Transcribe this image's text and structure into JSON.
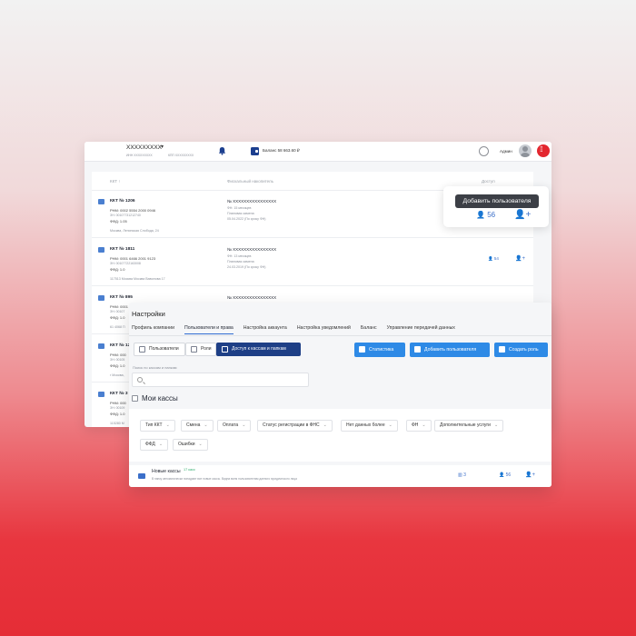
{
  "topbar": {
    "org_name": "XXXXXXXXX",
    "inn": "ИНН XXXXXXXXX",
    "kpp": "КПП XXXXXXXXX",
    "balance": "Баланс 58 663.60 ₽",
    "admin": "Админ"
  },
  "table": {
    "headers": {
      "kkt": "ККТ ↑",
      "fn": "Фискальный накопитель",
      "access": "Доступ"
    },
    "rows": [
      {
        "title": "ККТ № 1206",
        "l1": "РНМ: 0002 5554 2000 0946",
        "l2": "ЗН: 00107731212740",
        "l3": "ФФД: 1.05",
        "addr": "Москва, Ленинская Слобода, 24",
        "fn": "№ XXXXXXXXXXXXXXXX",
        "fn1": "ФН: 15 месяцев",
        "fn2": "Плановая замена",
        "fn3": "05.04.2022 (По сроку ФН)",
        "users": "",
        "add": ""
      },
      {
        "title": "ККТ № 1811",
        "l1": "РНМ: 0001 6466 2001 9123",
        "l2": "ЗН: 00107722163008",
        "l3": "ФФД: 1.0",
        "addr": "117513 Москва Москва Вавилова 17",
        "fn": "№ XXXXXXXXXXXXXXXX",
        "fn1": "ФН: 13 месяцев",
        "fn2": "Плановая замена",
        "fn3": "24.03.2019 (По сроку ФН)",
        "users": "54",
        "add": "+"
      },
      {
        "title": "ККТ № 895",
        "l1": "РНМ: 0001",
        "l2": "ЗН: 00107",
        "l3": "ФФД: 1.0",
        "addr": "61 4068 П",
        "fn": "№ XXXXXXXXXXXXXXXX",
        "fn1": "",
        "fn2": "",
        "fn3": "",
        "users": "",
        "add": ""
      },
      {
        "title": "ККТ № 12",
        "l1": "РНМ: 000",
        "l2": "ЗН: 00105",
        "l3": "ФФД: 1.0",
        "addr": "г Москва,",
        "fn": "",
        "fn1": "",
        "fn2": "",
        "fn3": "",
        "users": "",
        "add": ""
      },
      {
        "title": "ККТ № 3",
        "l1": "РНМ: 000",
        "l2": "ЗН: 00109",
        "l3": "ФФД: 1.0",
        "addr": "115280 М",
        "fn": "",
        "fn1": "",
        "fn2": "",
        "fn3": "",
        "users": "",
        "add": ""
      }
    ]
  },
  "popup": {
    "tooltip": "Добавить пользователя",
    "users": "56"
  },
  "settings": {
    "title": "Настройки",
    "tabs": [
      "Профиль компании",
      "Пользователи и права",
      "Настройка аккаунта",
      "Настройка уведомлений",
      "Баланс",
      "Управление передачей данных"
    ],
    "segments": [
      "Пользователи",
      "Роли",
      "Доступ к кассам и папкам"
    ],
    "buttons": [
      "Статистика",
      "Добавить пользователя",
      "Создать роль"
    ],
    "search_label": "Поиск по кассам и папкам",
    "search_placeholder": "",
    "mykassy": "Мои кассы",
    "filters_row1": [
      "Тип ККТ",
      "Смена",
      "Оплата",
      "Статус регистрации в ФНС",
      "Нет данных более",
      "ФН",
      "Дополнительные услуги"
    ],
    "filters_row2": [
      "ФФД",
      "Ошибки"
    ],
    "newrow": {
      "title": "Новые кассы",
      "count": "17 касс",
      "desc": "В папку автоматически попадают все новые кассы. Видна всем пользователям данного юридического лица",
      "kassy": "3",
      "users": "56",
      "add": "+"
    }
  }
}
